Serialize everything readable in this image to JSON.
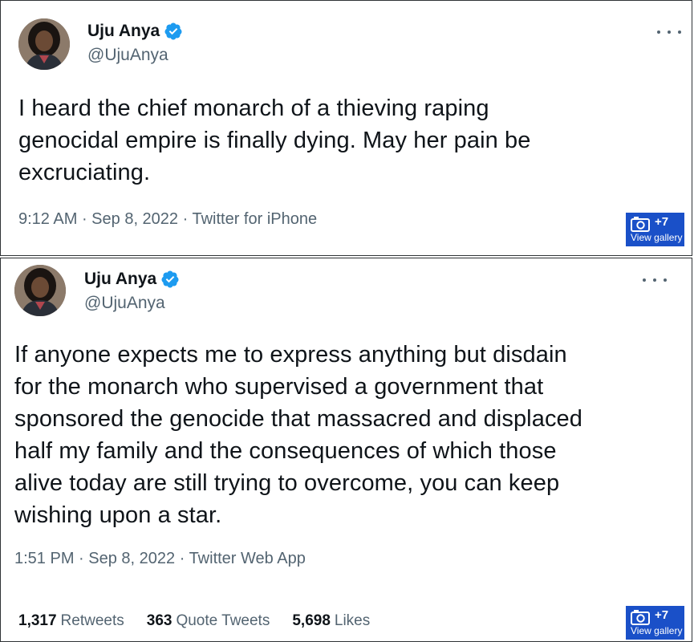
{
  "tweets": [
    {
      "name": "Uju Anya",
      "handle": "@UjuAnya",
      "lines": [
        "I heard the chief monarch of a thieving raping",
        "genocidal empire is finally dying. May her pain be",
        "excruciating."
      ],
      "time": "9:12 AM",
      "date": "Sep 8, 2022",
      "source": "Twitter for iPhone",
      "separator": " · "
    },
    {
      "name": "Uju Anya",
      "handle": "@UjuAnya",
      "lines": [
        "If anyone expects me to express anything but disdain",
        "for the monarch who supervised a government that",
        "sponsored the genocide that massacred and displaced",
        "half my family and the consequences of which those",
        "alive today are still trying to overcome, you can keep",
        "wishing upon a star."
      ],
      "time": "1:51 PM",
      "date": "Sep 8, 2022",
      "source": "Twitter Web App",
      "separator": " · ",
      "stats": {
        "retweets_count": "1,317",
        "retweets_label": "Retweets",
        "quotes_count": "363",
        "quotes_label": "Quote Tweets",
        "likes_count": "5,698",
        "likes_label": "Likes"
      }
    }
  ],
  "gallery": {
    "count": "+7",
    "label": "View gallery",
    "icon": "camera-icon",
    "color": "#1a50c8"
  },
  "icons": {
    "verified": "verified-badge-icon",
    "more": "more-options-icon"
  },
  "colors": {
    "verified": "#1d9bf0",
    "secondary_text": "#536471",
    "primary_text": "#0f1419"
  }
}
